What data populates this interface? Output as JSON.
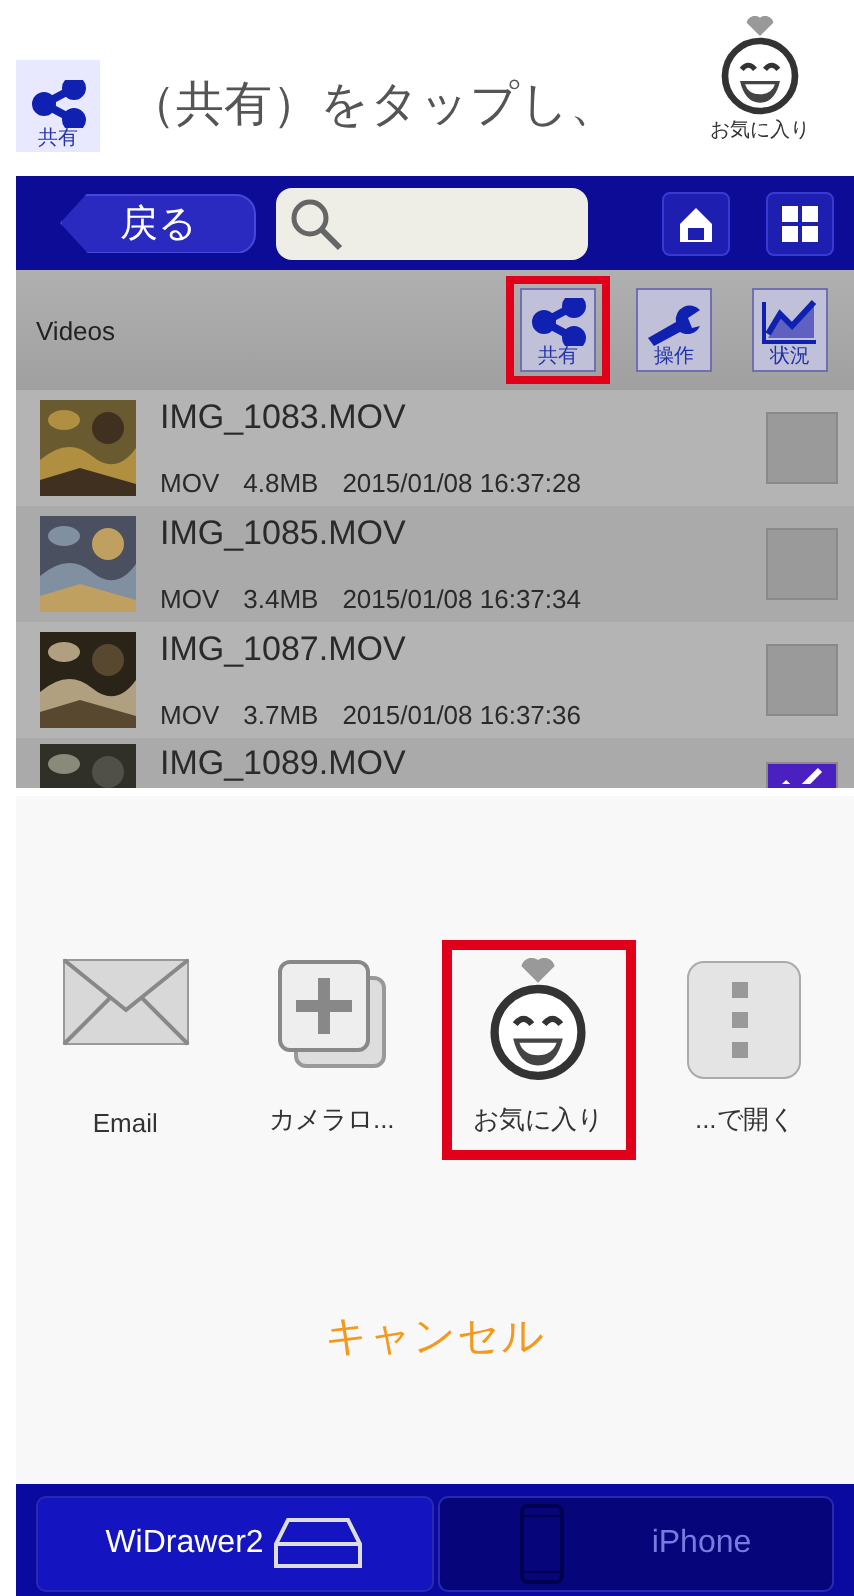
{
  "instruction": {
    "text": "（共有）をタップし、",
    "share_label": "共有",
    "favorite_label": "お気に入り"
  },
  "nav": {
    "back": "戻る"
  },
  "toolbar": {
    "title": "Videos",
    "buttons": [
      {
        "kind": "share",
        "label": "共有",
        "highlighted": true
      },
      {
        "kind": "tools",
        "label": "操作",
        "highlighted": false
      },
      {
        "kind": "chart",
        "label": "状況",
        "highlighted": false
      }
    ]
  },
  "videos": [
    {
      "name": "IMG_1083.MOV",
      "type": "MOV",
      "size": "4.8MB",
      "date": "2015/01/08 16:37:28",
      "checked": false
    },
    {
      "name": "IMG_1085.MOV",
      "type": "MOV",
      "size": "3.4MB",
      "date": "2015/01/08 16:37:34",
      "checked": false
    },
    {
      "name": "IMG_1087.MOV",
      "type": "MOV",
      "size": "3.7MB",
      "date": "2015/01/08 16:37:36",
      "checked": false
    },
    {
      "name": "IMG_1089.MOV",
      "checked": true
    }
  ],
  "share_sheet": {
    "actions": [
      {
        "kind": "email",
        "label": "Email",
        "highlighted": false
      },
      {
        "kind": "camera_roll",
        "label": "カメラロ...",
        "highlighted": false
      },
      {
        "kind": "favorite",
        "label": "お気に入り",
        "highlighted": true
      },
      {
        "kind": "open_in",
        "label": "...で開く",
        "highlighted": false
      }
    ],
    "cancel": "キャンセル"
  },
  "tabs": [
    {
      "kind": "drive",
      "label": "WiDrawer2",
      "selected": true
    },
    {
      "kind": "phone",
      "label": "iPhone",
      "selected": false
    }
  ]
}
